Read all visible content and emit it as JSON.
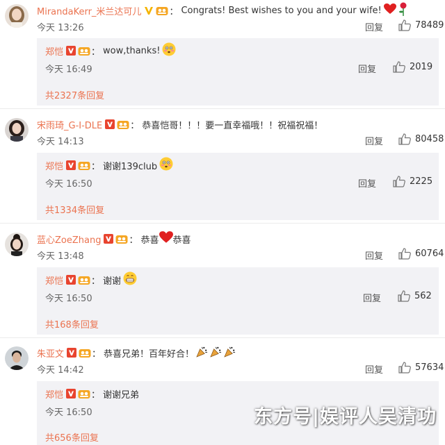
{
  "comments": [
    {
      "user": "MirandaKerr_米兰达可儿",
      "badge": "gold-v-badge",
      "avatar": "avatar-woman-light-hair",
      "text": "Congrats!  Best wishes to you and your wife!",
      "emojis": [
        "red-heart-emoji",
        "rose-emoji"
      ],
      "time": "今天 13:26",
      "reply_label": "回复",
      "likes": "78489",
      "reply": {
        "user": "郑恺",
        "text": "wow,thanks!",
        "emojis": [
          "flushed-face-emoji"
        ],
        "time": "今天 16:49",
        "reply_label": "回复",
        "likes": "2019"
      },
      "total_replies": "共2327条回复"
    },
    {
      "user": "宋雨琦_G-I-DLE",
      "badge": "red-v-badge",
      "avatar": "avatar-woman-dark-hair",
      "text": "恭喜恺哥！！！要一直幸福哦！！祝福祝福！",
      "emojis": [],
      "time": "今天 14:13",
      "reply_label": "回复",
      "likes": "80458",
      "reply": {
        "user": "郑恺",
        "text": "谢谢139club",
        "emojis": [
          "flushed-face-emoji"
        ],
        "time": "今天 16:50",
        "reply_label": "回复",
        "likes": "2225"
      },
      "total_replies": "共1334条回复"
    },
    {
      "user": "蓝心ZoeZhang",
      "badge": "red-v-badge",
      "avatar": "avatar-woman-updo",
      "text": "恭喜",
      "text2": "恭喜",
      "emojis": [
        "red-heart-emoji"
      ],
      "time": "今天 13:48",
      "reply_label": "回复",
      "likes": "60764",
      "reply": {
        "user": "郑恺",
        "text": "谢谢",
        "emojis": [
          "grinning-face-emoji"
        ],
        "time": "今天 16:50",
        "reply_label": "回复",
        "likes": "562"
      },
      "total_replies": "共168条回复"
    },
    {
      "user": "朱亚文",
      "badge": "red-v-badge",
      "avatar": "avatar-man",
      "text": "恭喜兄弟！百年好合！",
      "emojis": [
        "party-popper-emoji",
        "party-popper-emoji",
        "party-popper-emoji"
      ],
      "time": "今天 14:42",
      "reply_label": "回复",
      "likes": "57634",
      "reply": {
        "user": "郑恺",
        "text": "谢谢兄弟",
        "emojis": [],
        "time": "今天 16:50",
        "reply_label": "回复",
        "likes": ""
      },
      "total_replies": "共656条回复"
    }
  ],
  "watermark": "东方号|娱评人吴清功",
  "colors": {
    "username": "#eb7350",
    "reply_bg": "#f2f2f5",
    "v_badge_red": "#e8442f",
    "v_badge_gold": "#f4b400",
    "group_badge": "#f5a623"
  },
  "icons": {
    "like": "thumbs-up-icon",
    "group_badge": "group-member-badge-icon"
  }
}
